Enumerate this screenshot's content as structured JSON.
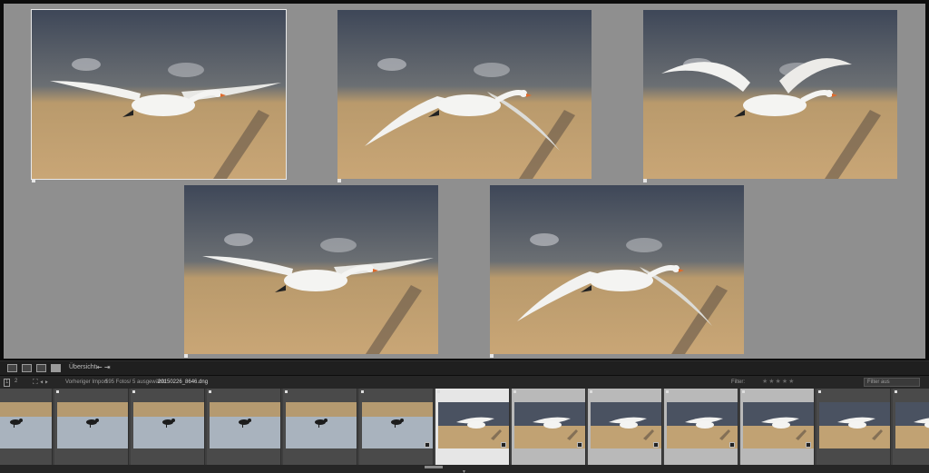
{
  "survey": {
    "photos": [
      {
        "pose": "glide",
        "selected": true
      },
      {
        "pose": "down",
        "selected": false
      },
      {
        "pose": "up",
        "selected": false
      },
      {
        "pose": "glide",
        "selected": false
      },
      {
        "pose": "down",
        "selected": false
      }
    ]
  },
  "toolbar": {
    "label": "Übersicht:",
    "arrows": "⇤ ⇥"
  },
  "filmstrip_header": {
    "page1": "1",
    "page2": "2",
    "nav_icons": "⛶ ◂ ▸",
    "source": "Vorheriger Import",
    "count": "595 Fotos/ 5 ausgewählt/",
    "file": "20150226_8646.dng",
    "filter_label": "Filter:",
    "stars": "★★★★★",
    "filter_value": "Filter aus"
  },
  "filmstrip": {
    "items": [
      {
        "type": "bird",
        "state": "normal"
      },
      {
        "type": "bird",
        "state": "normal"
      },
      {
        "type": "bird",
        "state": "normal"
      },
      {
        "type": "bird",
        "state": "normal"
      },
      {
        "type": "bird",
        "state": "normal"
      },
      {
        "type": "bird",
        "state": "normal"
      },
      {
        "type": "swan",
        "state": "primary"
      },
      {
        "type": "swan",
        "state": "sel"
      },
      {
        "type": "swan",
        "state": "sel"
      },
      {
        "type": "swan",
        "state": "sel"
      },
      {
        "type": "swan",
        "state": "sel"
      },
      {
        "type": "swan",
        "state": "normal"
      },
      {
        "type": "swan",
        "state": "normal"
      }
    ]
  },
  "colors": {
    "survey_bg": "#8f8f8f",
    "reeds": "#c6a373",
    "sky": "#3e4758",
    "selection": "#e6e6e6"
  }
}
